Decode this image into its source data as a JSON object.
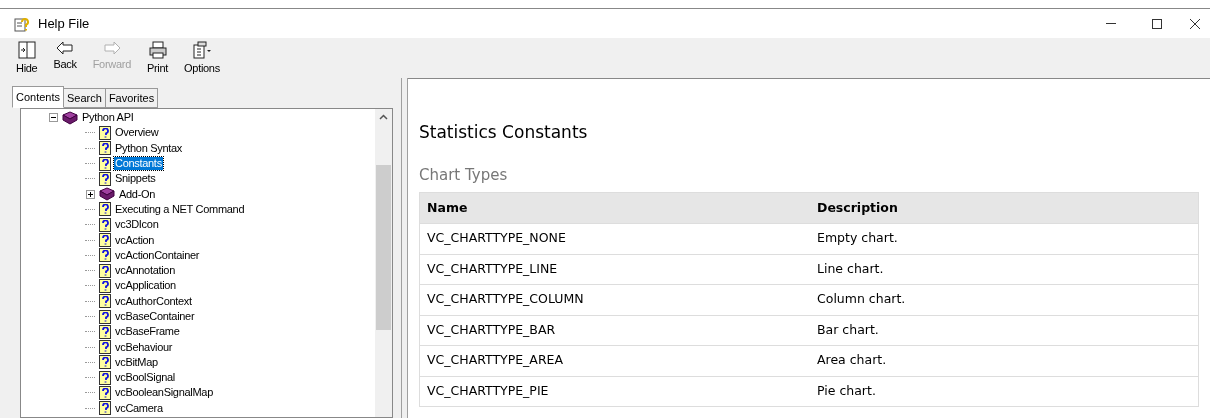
{
  "window": {
    "title": "Help File"
  },
  "toolbar": [
    {
      "label": "Hide",
      "disabled": false,
      "kind": "hide"
    },
    {
      "label": "Back",
      "disabled": false,
      "kind": "back"
    },
    {
      "label": "Forward",
      "disabled": true,
      "kind": "forward"
    },
    {
      "label": "Print",
      "disabled": false,
      "kind": "print"
    },
    {
      "label": "Options",
      "disabled": false,
      "kind": "options"
    }
  ],
  "tabs": [
    {
      "label": "Contents",
      "selected": true
    },
    {
      "label": "Search",
      "selected": false
    },
    {
      "label": "Favorites",
      "selected": false
    }
  ],
  "tree": [
    {
      "label": "Python API",
      "kind": "book",
      "expanded": true,
      "selected": false,
      "children": [
        {
          "label": "Overview",
          "kind": "page",
          "selected": false
        },
        {
          "label": "Python Syntax",
          "kind": "page",
          "selected": false
        },
        {
          "label": "Constants",
          "kind": "page",
          "selected": true
        },
        {
          "label": "Snippets",
          "kind": "page",
          "selected": false
        },
        {
          "label": "Add-On",
          "kind": "book",
          "expanded": false,
          "selected": false
        },
        {
          "label": "Executing a NET Command",
          "kind": "page",
          "selected": false
        },
        {
          "label": "vc3DIcon",
          "kind": "page",
          "selected": false
        },
        {
          "label": "vcAction",
          "kind": "page",
          "selected": false
        },
        {
          "label": "vcActionContainer",
          "kind": "page",
          "selected": false
        },
        {
          "label": "vcAnnotation",
          "kind": "page",
          "selected": false
        },
        {
          "label": "vcApplication",
          "kind": "page",
          "selected": false
        },
        {
          "label": "vcAuthorContext",
          "kind": "page",
          "selected": false
        },
        {
          "label": "vcBaseContainer",
          "kind": "page",
          "selected": false
        },
        {
          "label": "vcBaseFrame",
          "kind": "page",
          "selected": false
        },
        {
          "label": "vcBehaviour",
          "kind": "page",
          "selected": false
        },
        {
          "label": "vcBitMap",
          "kind": "page",
          "selected": false
        },
        {
          "label": "vcBoolSignal",
          "kind": "page",
          "selected": false
        },
        {
          "label": "vcBooleanSignalMap",
          "kind": "page",
          "selected": false
        },
        {
          "label": "vcCamera",
          "kind": "page",
          "selected": false
        }
      ]
    }
  ],
  "content": {
    "title": "Statistics Constants",
    "section": "Chart Types",
    "table": {
      "columns": [
        "Name",
        "Description"
      ],
      "rows": [
        [
          "VC_CHARTTYPE_NONE",
          "Empty chart."
        ],
        [
          "VC_CHARTTYPE_LINE",
          "Line chart."
        ],
        [
          "VC_CHARTTYPE_COLUMN",
          "Column chart."
        ],
        [
          "VC_CHARTTYPE_BAR",
          "Bar chart."
        ],
        [
          "VC_CHARTTYPE_AREA",
          "Area chart."
        ],
        [
          "VC_CHARTTYPE_PIE",
          "Pie chart."
        ]
      ]
    }
  }
}
